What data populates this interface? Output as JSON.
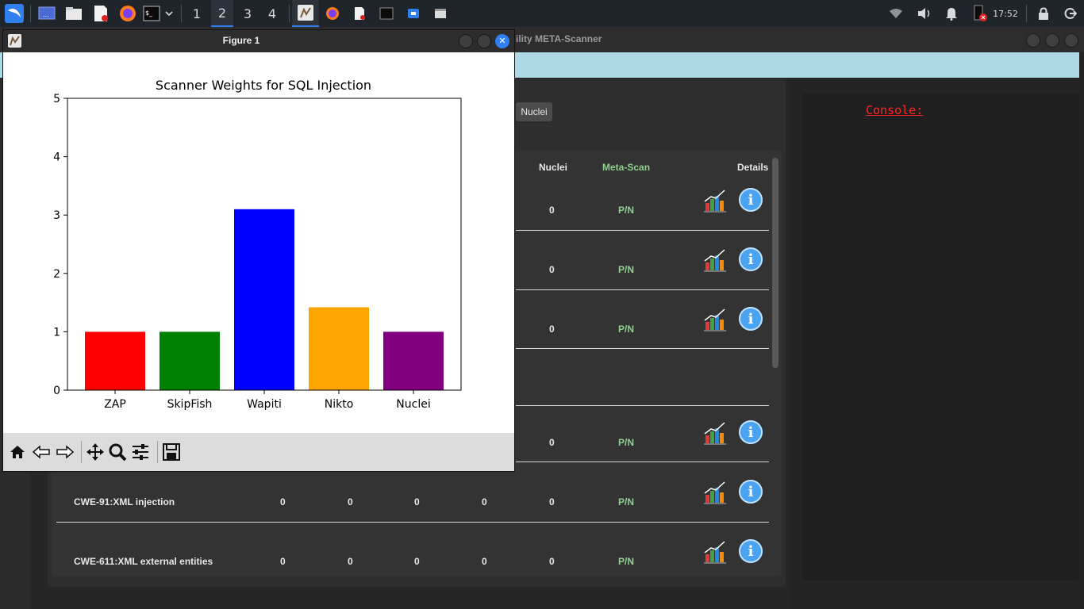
{
  "taskbar": {
    "workspaces": [
      "1",
      "2",
      "3",
      "4"
    ],
    "active_workspace": "2",
    "clock": "17:52",
    "icons": [
      "kali-menu-icon",
      "desktop-icon",
      "file-manager-icon",
      "text-editor-icon",
      "firefox-icon",
      "terminal-icon",
      "wifi-icon",
      "volume-icon",
      "bell-icon",
      "battery-icon",
      "lock-icon",
      "logout-icon"
    ]
  },
  "app": {
    "title": "ility META-Scanner",
    "banner_color": "#add8e6",
    "tab_nuclei": "Nuclei",
    "headers": {
      "nuclei": "Nuclei",
      "metascan": "Meta-Scan",
      "details": "Details"
    },
    "rows": [
      {
        "name": "",
        "values": [
          "",
          "",
          "",
          "",
          "0"
        ],
        "meta": "P/N"
      },
      {
        "name": "",
        "values": [
          "",
          "",
          "",
          "",
          "0"
        ],
        "meta": "P/N"
      },
      {
        "name": "",
        "values": [
          "",
          "",
          "",
          "",
          "0"
        ],
        "meta": "P/N"
      },
      {
        "name": "",
        "values": [
          "",
          "",
          "",
          "",
          "0"
        ],
        "meta": "P/N"
      },
      {
        "name": "CWE-91:XML injection",
        "values": [
          "0",
          "0",
          "0",
          "0",
          "0"
        ],
        "meta": "P/N"
      },
      {
        "name": "CWE-611:XML external entities",
        "values": [
          "0",
          "0",
          "0",
          "0",
          "0"
        ],
        "meta": "P/N"
      }
    ],
    "console_label": "Console:"
  },
  "figure": {
    "window_title": "Figure 1",
    "toolbar": [
      "home-icon",
      "back-icon",
      "forward-icon",
      "pan-icon",
      "zoom-icon",
      "configure-icon",
      "save-icon"
    ]
  },
  "chart_data": {
    "type": "bar",
    "title": "Scanner Weights for SQL Injection",
    "categories": [
      "ZAP",
      "SkipFish",
      "Wapiti",
      "Nikto",
      "Nuclei"
    ],
    "values": [
      1.0,
      1.0,
      3.1,
      1.42,
      1.0
    ],
    "colors": [
      "#ff0000",
      "#008000",
      "#0000ff",
      "#ffa500",
      "#800080"
    ],
    "ylim": [
      0,
      5
    ],
    "yticks": [
      0,
      1,
      2,
      3,
      4,
      5
    ],
    "xlabel": "",
    "ylabel": "",
    "grid": false
  }
}
